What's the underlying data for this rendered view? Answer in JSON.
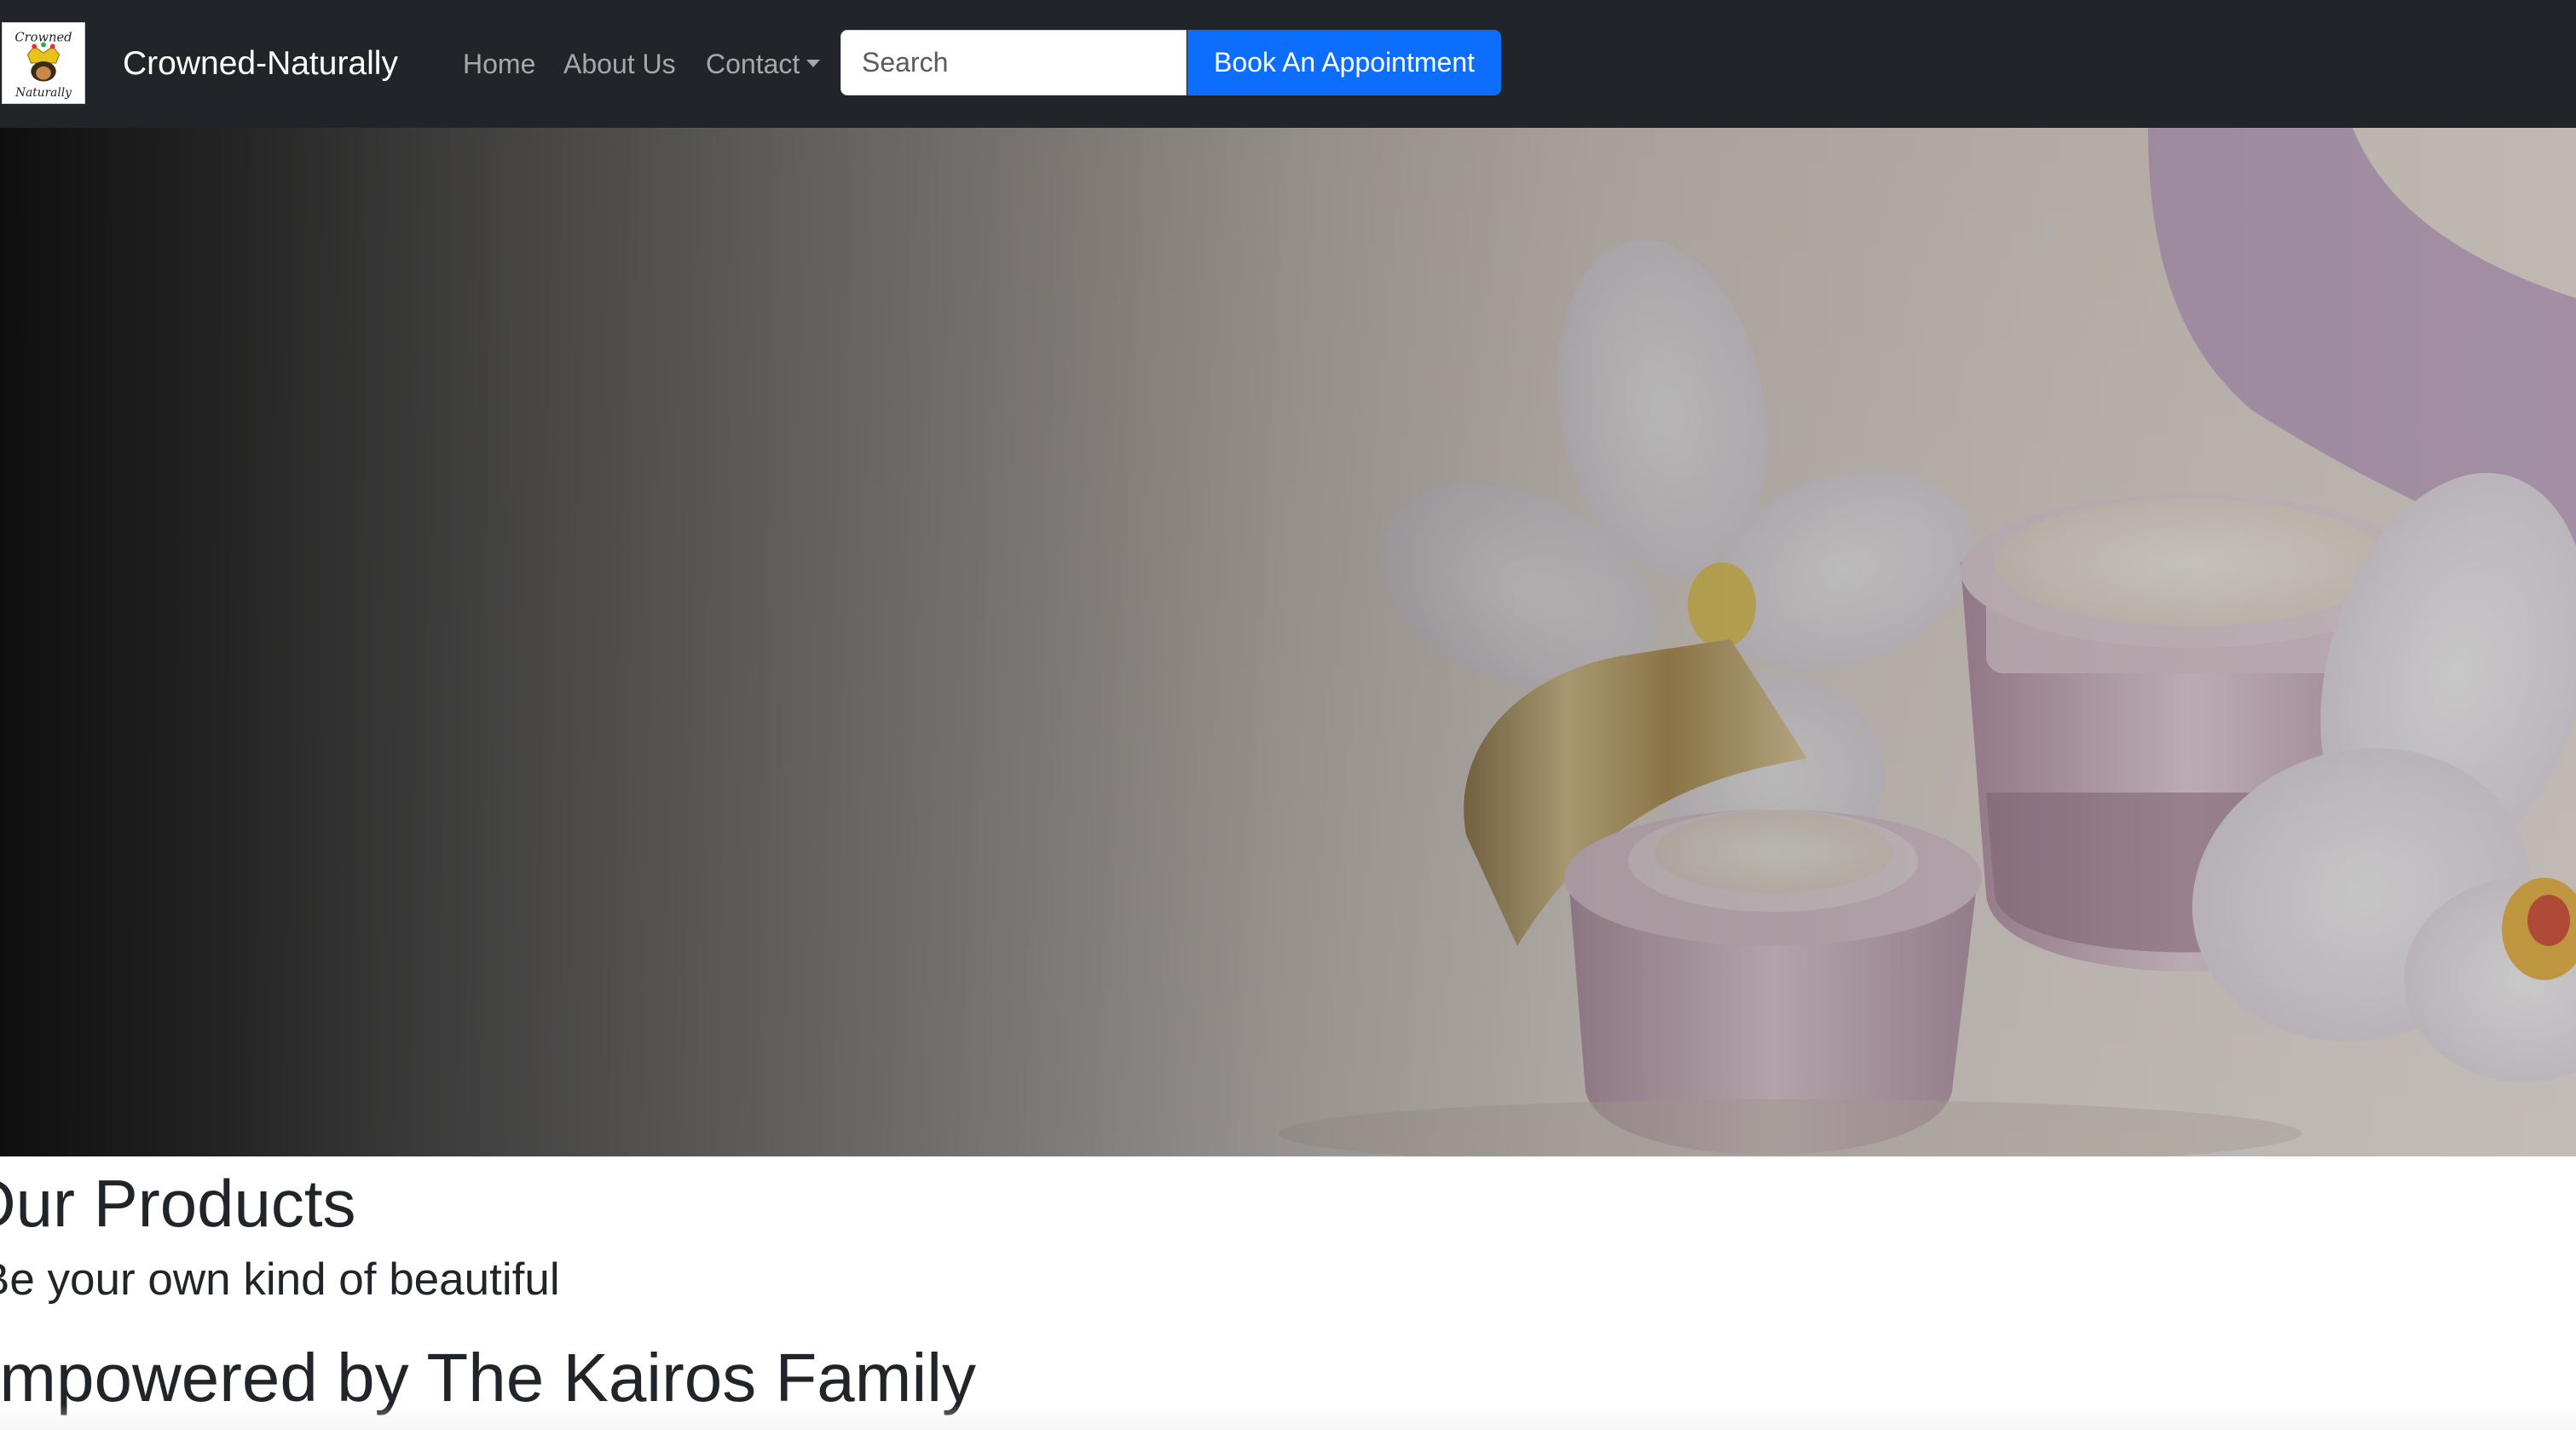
{
  "navbar": {
    "logo_text_top": "Crowned",
    "logo_text_bottom": "Naturally",
    "brand": "Crowned-Naturally",
    "links": {
      "home": "Home",
      "about": "About Us",
      "contact": "Contact"
    },
    "search": {
      "placeholder": "Search",
      "value": ""
    },
    "book_button": "Book An Appointment"
  },
  "hero": {
    "image": "skincare-cream-jars-with-orchids"
  },
  "content": {
    "heading": "Our Products",
    "tagline": "Be your own kind of beautiful",
    "empowered": "Empowered by The Kairos Family"
  },
  "colors": {
    "navbar_bg": "#212529",
    "accent": "#0d6efd",
    "text": "#212529",
    "nav_link": "rgba(255,255,255,0.6)"
  }
}
